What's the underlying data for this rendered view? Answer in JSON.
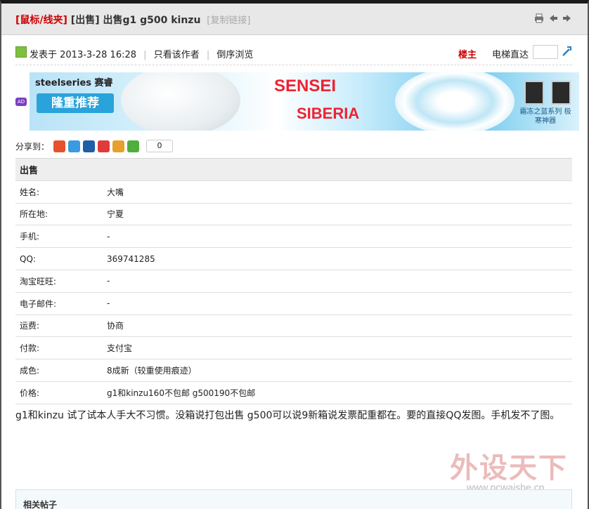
{
  "title": {
    "category": "[鼠标/线夹]",
    "tag": "[出售]",
    "subject": "出售g1 g500 kinzu",
    "copy_link": "[复制链接]"
  },
  "meta": {
    "posted_at": "发表于 2013-3-28 16:28",
    "only_author": "只看该作者",
    "reverse_order": "倒序浏览",
    "floor": "楼主",
    "elevator": "电梯直达"
  },
  "banner": {
    "brand": "steelseries 赛睿",
    "promo": "隆重推荐",
    "product1": "SENSEI",
    "product2": "SIBERIA",
    "series": "霜冻之蓝系列 极寒神器"
  },
  "share": {
    "label": "分享到：",
    "count": "0"
  },
  "table": {
    "heading": "出售",
    "rows": [
      {
        "key": "姓名:",
        "value": "大嘴"
      },
      {
        "key": "所在地:",
        "value": "宁夏"
      },
      {
        "key": "手机:",
        "value": "-"
      },
      {
        "key": "QQ:",
        "value": "369741285"
      },
      {
        "key": "淘宝旺旺:",
        "value": "-"
      },
      {
        "key": "电子邮件:",
        "value": "-"
      },
      {
        "key": "运费:",
        "value": "协商"
      },
      {
        "key": "付款:",
        "value": "支付宝"
      },
      {
        "key": "成色:",
        "value": "8成新（较重使用痕迹）"
      },
      {
        "key": "价格:",
        "value": "g1和kinzu160不包邮 g500190不包邮"
      }
    ]
  },
  "message": "g1和kinzu 试了试本人手大不习惯。没箱说打包出售    g500可以说9新箱说发票配重都在。要的直接QQ发图。手机发不了图。",
  "watermark": {
    "text": "外设天下",
    "url": "www.pcwaishe.cn"
  },
  "related": {
    "label": "相关帖子"
  },
  "colors": {
    "accent_red": "#cc0000",
    "header_bg": "#e8e8e8",
    "table_head_bg": "#eeeeee"
  }
}
